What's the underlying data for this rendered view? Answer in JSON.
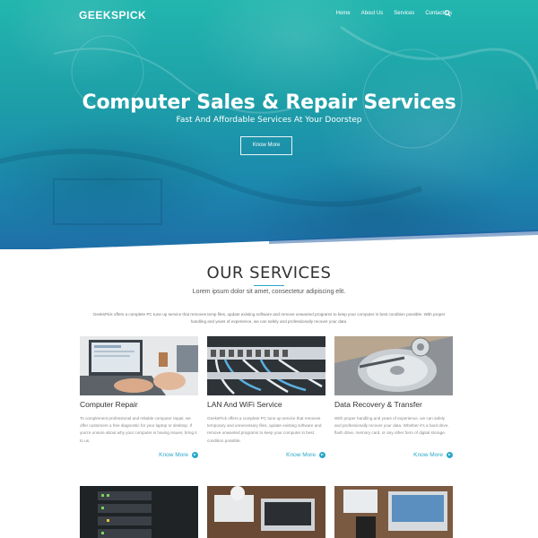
{
  "brand": {
    "name": "GEEKSPICK"
  },
  "nav": {
    "items": [
      "Home",
      "About Us",
      "Services",
      "Contact Us"
    ],
    "search_icon": "search-icon"
  },
  "hero": {
    "title": "Computer Sales & Repair Services",
    "subtitle": "Fast And Affordable Services At Your Doorstep",
    "button": "Know More"
  },
  "services": {
    "title": "OUR SERVICES",
    "lead": "Lorem ipsum dolor sit amet, consectetur adipiscing elit.",
    "description": "GeeksPick offers a complete PC tune up service that removes temp files, update existing software and remove unwanted programs to keep your computer in best condition possible. With proper handling and years of experience, we can safely and professionally recover your data.",
    "accent_color": "#2aa8c9",
    "cards": [
      {
        "title": "Computer Repair",
        "text": "To complement professional and reliable computer repair, we offer customers a free diagnostic for your laptop or desktop. If you're unsure about why your computer is having issues, bring it to us.",
        "more": "Know More"
      },
      {
        "title": "LAN And WiFi Service",
        "text": "GeeksPick offers a complete PC tune up service that removes temporary and unnecessary files, update existing software and remove unwanted programs to keep your computer in best condition possible.",
        "more": "Know More"
      },
      {
        "title": "Data Recovery & Transfer",
        "text": "With proper handling and years of experience, we can safely and professionally recover your data. Whether it's a hard drive, flash drive, memory card, or any other form of digital storage.",
        "more": "Know More"
      }
    ]
  }
}
